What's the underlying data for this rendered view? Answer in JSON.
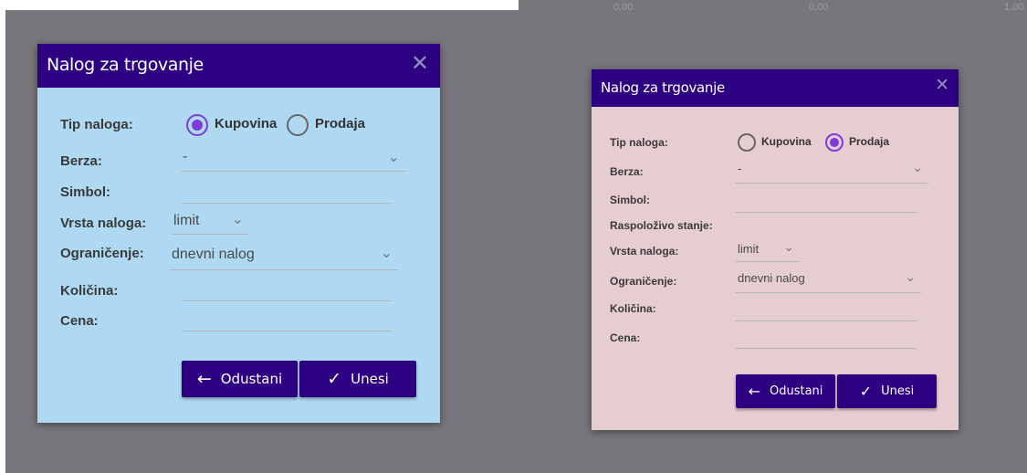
{
  "background": {
    "faint_values": [
      "0,00",
      "0,00",
      "1.00"
    ]
  },
  "left_dialog": {
    "title": "Nalog za trgovanje",
    "close_icon": "close-icon",
    "labels": {
      "tip_naloga": "Tip naloga:",
      "berza": "Berza:",
      "simbol": "Simbol:",
      "vrsta_naloga": "Vrsta naloga:",
      "ogranicenje": "Ograničenje:",
      "kolicina": "Količina:",
      "cena": "Cena:"
    },
    "radio": {
      "kupovina": "Kupovina",
      "prodaja": "Prodaja",
      "selected": "kupovina"
    },
    "berza_value": "-",
    "simbol_value": "",
    "vrsta_value": "limit",
    "ogranicenje_value": "dnevni nalog",
    "kolicina_value": "",
    "cena_value": "",
    "buttons": {
      "cancel": "Odustani",
      "submit": "Unesi"
    },
    "background_color": "#afd9f2"
  },
  "right_dialog": {
    "title": "Nalog za trgovanje",
    "close_icon": "close-icon",
    "labels": {
      "tip_naloga": "Tip naloga:",
      "berza": "Berza:",
      "simbol": "Simbol:",
      "raspolozivo": "Raspoloživo stanje:",
      "vrsta_naloga": "Vrsta naloga:",
      "ogranicenje": "Ograničenje:",
      "kolicina": "Količina:",
      "cena": "Cena:"
    },
    "radio": {
      "kupovina": "Kupovina",
      "prodaja": "Prodaja",
      "selected": "prodaja"
    },
    "berza_value": "-",
    "simbol_value": "",
    "vrsta_value": "limit",
    "ogranicenje_value": "dnevni nalog",
    "kolicina_value": "",
    "cena_value": "",
    "buttons": {
      "cancel": "Odustani",
      "submit": "Unesi"
    },
    "background_color": "#e6cdd1"
  },
  "colors": {
    "titlebar": "#2c0080",
    "radio_accent": "#7d3cd8",
    "overlay": "#77767b"
  }
}
